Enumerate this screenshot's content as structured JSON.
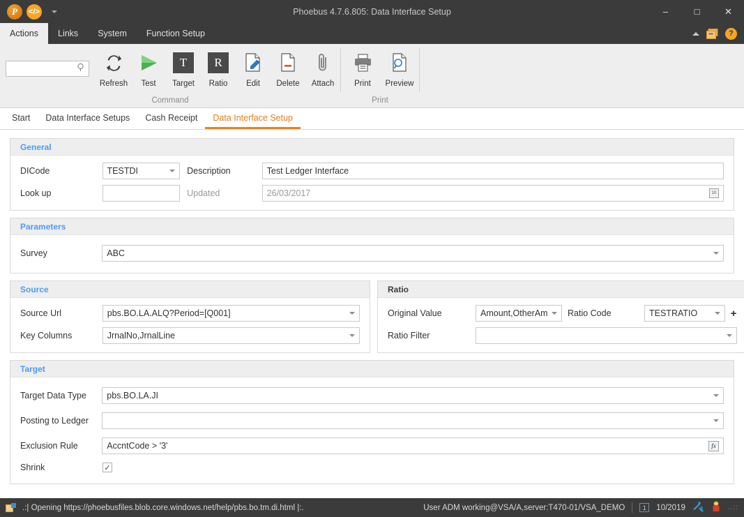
{
  "window": {
    "title": "Phoebus 4.7.6.805: Data Interface Setup",
    "minimize_label": "–",
    "maximize_label": "□",
    "close_label": "✕",
    "quick_access": [
      {
        "name": "phoebus-logo-icon",
        "label": "P"
      },
      {
        "name": "code-icon",
        "label": "</>"
      }
    ]
  },
  "menubar": {
    "items": [
      {
        "label": "Actions",
        "active": true
      },
      {
        "label": "Links",
        "active": false
      },
      {
        "label": "System",
        "active": false
      },
      {
        "label": "Function Setup",
        "active": false
      }
    ],
    "right_icons": [
      {
        "name": "collapse-ribbon-caret-icon",
        "label": ""
      },
      {
        "name": "windows-icon",
        "label": ""
      },
      {
        "name": "help-icon",
        "label": "?"
      }
    ]
  },
  "ribbon": {
    "search": {
      "value": "",
      "placeholder": "",
      "icon": "search-icon"
    },
    "groups": [
      {
        "label": "Command",
        "buttons": [
          {
            "label": "Refresh",
            "icon": "refresh-icon"
          },
          {
            "label": "Test",
            "icon": "play-icon"
          },
          {
            "label": "Target",
            "icon": "target-t-icon",
            "glyph": "T"
          },
          {
            "label": "Ratio",
            "icon": "ratio-r-icon",
            "glyph": "R"
          },
          {
            "label": "Edit",
            "icon": "edit-pencil-icon"
          },
          {
            "label": "Delete",
            "icon": "delete-document-icon"
          },
          {
            "label": "Attach",
            "icon": "paperclip-icon"
          }
        ]
      },
      {
        "label": "Print",
        "buttons": [
          {
            "label": "Print",
            "icon": "printer-icon"
          },
          {
            "label": "Preview",
            "icon": "print-preview-icon"
          }
        ]
      }
    ]
  },
  "tabs": [
    {
      "label": "Start",
      "active": false
    },
    {
      "label": "Data Interface Setups",
      "active": false
    },
    {
      "label": "Cash Receipt",
      "active": false
    },
    {
      "label": "Data Interface Setup",
      "active": true
    }
  ],
  "panels": {
    "general": {
      "title": "General",
      "dicode_label": "DICode",
      "dicode_value": "TESTDI",
      "description_label": "Description",
      "description_value": "Test Ledger Interface",
      "lookup_label": "Look up",
      "lookup_value": "",
      "updated_label": "Updated",
      "updated_value": "26/03/2017"
    },
    "parameters": {
      "title": "Parameters",
      "survey_label": "Survey",
      "survey_value": "ABC"
    },
    "source": {
      "title": "Source",
      "source_url_label": "Source Url",
      "source_url_value": "pbs.BO.LA.ALQ?Period=[Q001]",
      "key_columns_label": "Key Columns",
      "key_columns_value": "JrnalNo,JrnalLine"
    },
    "ratio": {
      "title": "Ratio",
      "original_value_label": "Original Value",
      "original_value_value": "Amount,OtherAm",
      "ratio_code_label": "Ratio Code",
      "ratio_code_value": "TESTRATIO",
      "ratio_code_add_label": "+",
      "ratio_filter_label": "Ratio Filter",
      "ratio_filter_value": ""
    },
    "target": {
      "title": "Target",
      "target_data_type_label": "Target Data Type",
      "target_data_type_value": "pbs.BO.LA.JI",
      "posting_to_ledger_label": "Posting to Ledger",
      "posting_to_ledger_value": "",
      "exclusion_rule_label": "Exclusion Rule",
      "exclusion_rule_value": "AccntCode > '3'",
      "exclusion_rule_fx_label": "fx",
      "shrink_label": "Shrink",
      "shrink_checked_glyph": "✓"
    }
  },
  "statusbar": {
    "message": ".:| Opening https://phoebusfiles.blob.core.windows.net/help/pbs.bo.tm.di.html |:.",
    "user_info": "User ADM working@VSA/A,server:T470-01/VSA_DEMO",
    "page_number": "1",
    "period": "10/2019",
    "icons": [
      {
        "name": "tools-icon",
        "label": ""
      },
      {
        "name": "figure-icon",
        "label": ""
      }
    ],
    "grip": "..::"
  },
  "colors": {
    "accent_orange": "#f07f1a",
    "panel_header_blue": "#4a9cf6",
    "chrome_dark": "#3b3b3b",
    "ribbon_bg": "#eeeeee"
  }
}
